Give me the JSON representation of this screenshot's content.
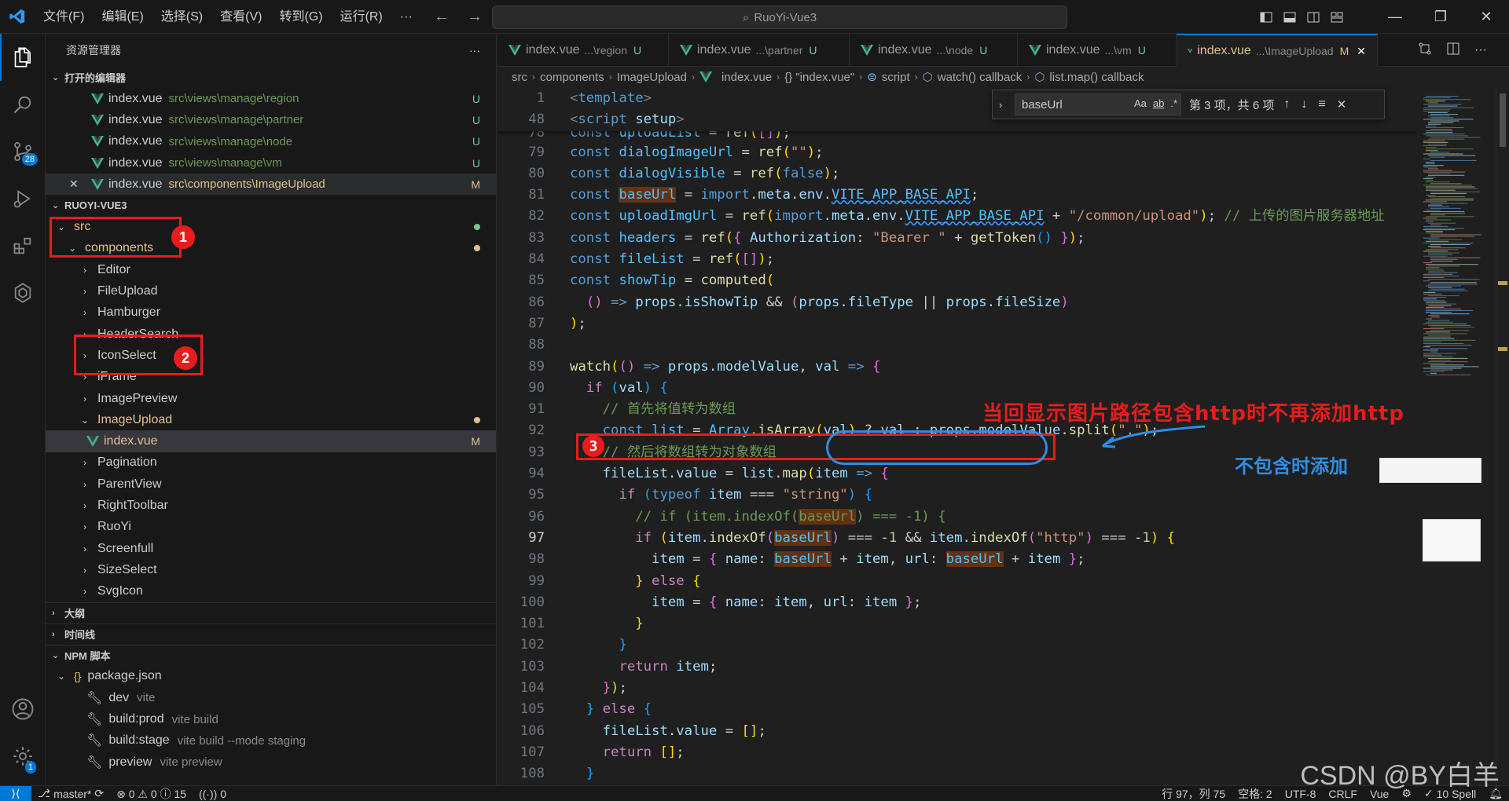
{
  "menu": [
    "文件(F)",
    "编辑(E)",
    "选择(S)",
    "查看(V)",
    "转到(G)",
    "运行(R)",
    "···"
  ],
  "search": {
    "text": "RuoYi-Vue3"
  },
  "sidebar": {
    "title": "资源管理器",
    "more": "···",
    "open_editors": {
      "title": "打开的编辑器",
      "items": [
        {
          "name": "index.vue",
          "path": "src\\views\\manage\\region",
          "status": "U"
        },
        {
          "name": "index.vue",
          "path": "src\\views\\manage\\partner",
          "status": "U"
        },
        {
          "name": "index.vue",
          "path": "src\\views\\manage\\node",
          "status": "U"
        },
        {
          "name": "index.vue",
          "path": "src\\views\\manage\\vm",
          "status": "U"
        },
        {
          "name": "index.vue",
          "path": "src\\components\\ImageUpload",
          "status": "M",
          "close": "✕"
        }
      ]
    },
    "project": {
      "title": "RUOYI-VUE3",
      "src": "src",
      "components": "components",
      "folders_before": [
        "Editor",
        "FileUpload",
        "Hamburger",
        "HeaderSearch",
        "IconSelect",
        "iFrame",
        "ImagePreview"
      ],
      "image_upload": "ImageUpload",
      "index_vue": "index.vue",
      "index_status": "M",
      "folders_after": [
        "Pagination",
        "ParentView",
        "RightToolbar",
        "RuoYi",
        "Screenfull",
        "SizeSelect",
        "SvgIcon"
      ]
    },
    "outline": "大纲",
    "timeline": "时间线",
    "npm": {
      "title": "NPM 脚本",
      "package": "package.json",
      "scripts": [
        {
          "name": "dev",
          "cmd": "vite"
        },
        {
          "name": "build:prod",
          "cmd": "vite build"
        },
        {
          "name": "build:stage",
          "cmd": "vite build --mode staging"
        },
        {
          "name": "preview",
          "cmd": "vite preview"
        }
      ]
    }
  },
  "badges": {
    "scm": "28",
    "settings": "1"
  },
  "tabs": [
    {
      "name": "index.vue",
      "sub": "...\\region",
      "status": "U",
      "active": false
    },
    {
      "name": "index.vue",
      "sub": "...\\partner",
      "status": "U",
      "active": false
    },
    {
      "name": "index.vue",
      "sub": "...\\node",
      "status": "U",
      "active": false
    },
    {
      "name": "index.vue",
      "sub": "...\\vm",
      "status": "U",
      "active": false
    },
    {
      "name": "index.vue",
      "sub": "...\\ImageUpload",
      "status": "M",
      "active": true,
      "close": "✕"
    }
  ],
  "breadcrumb": [
    "src",
    "components",
    "ImageUpload",
    "index.vue",
    "{} \"index.vue\"",
    "script",
    "watch() callback",
    "list.map() callback"
  ],
  "find": {
    "value": "baseUrl",
    "result": "第 3 项，共 6 项",
    "opt_case": "Aa",
    "opt_word": "ab",
    "opt_regex": ".*"
  },
  "annotations": {
    "n1": "1",
    "n2": "2",
    "n3": "3",
    "red_note": "当回显示图片路径包含http时不再添加http",
    "blue_note": "不包含时添加",
    "watermark": "CSDN @BY白羊"
  },
  "status": {
    "branch": "master*",
    "problems": "⊗ 0 ⚠ 0 ⓘ 15",
    "ports": "0",
    "pos": "行 97，列 75",
    "spaces": "空格: 2",
    "enc": "UTF-8",
    "eol": "CRLF",
    "lang": "Vue",
    "spell": "10 Spell"
  }
}
